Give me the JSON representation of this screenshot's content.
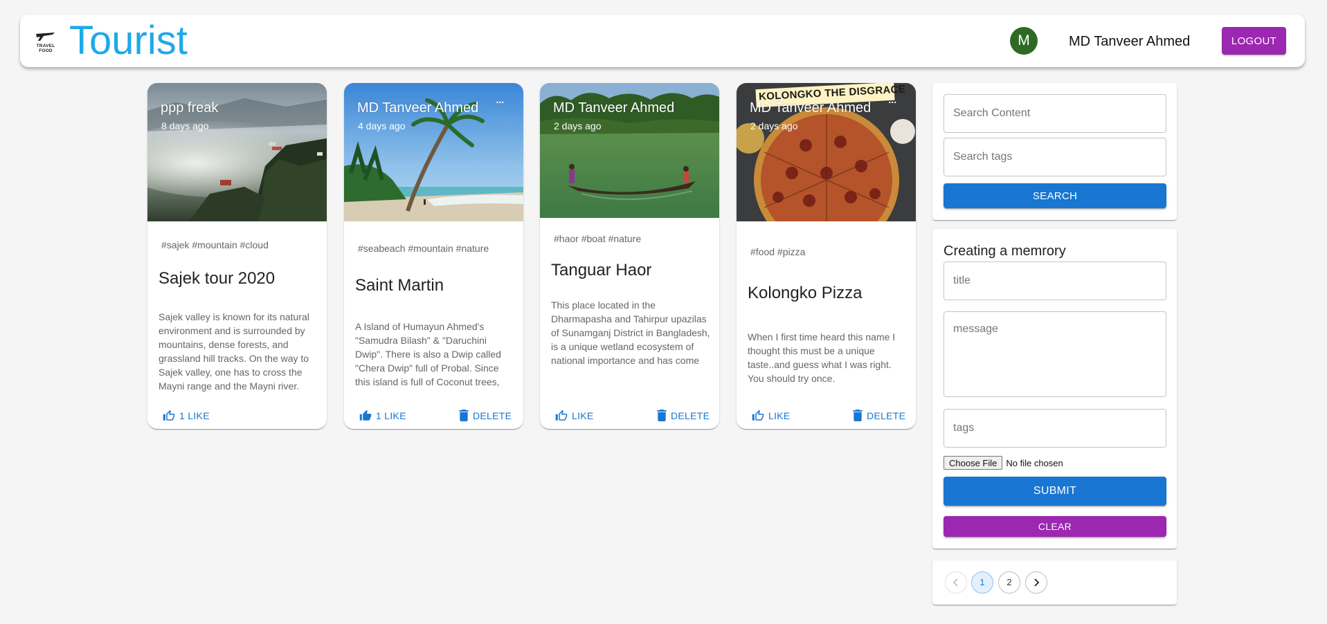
{
  "header": {
    "logo_text": [
      "TRAVEL",
      "FOOD"
    ],
    "brand": "Tourist",
    "avatar_initial": "M",
    "username": "MD Tanveer Ahmed",
    "logout_label": "LOGOUT"
  },
  "posts": [
    {
      "author": "ppp freak",
      "time": "8 days ago",
      "tags": "#sajek #mountain #cloud",
      "title": "Sajek tour 2020",
      "message": "Sajek valley is known for its natural environment and is surrounded by mountains, dense forests, and grassland hill tracks. On the way to Sajek valley, one has to cross the Mayni range and the Mayni river.",
      "like_label": "1 LIKE",
      "image": "mountain-fog-photo"
    },
    {
      "author": "MD Tanveer Ahmed",
      "time": "4 days ago",
      "more": "...",
      "tags": "#seabeach #mountain #nature",
      "title": "Saint Martin",
      "message": "A Island of Humayun Ahmed's \"Samudra Bilash\" & \"Daruchini Dwip\". There is also a Dwip called \"Chera Dwip\" full of Probal. Since this island is full of Coconut trees,",
      "like_label": "1 LIKE",
      "delete_label": "DELETE",
      "image": "beach-palm-photo"
    },
    {
      "author": "MD Tanveer Ahmed",
      "time": "2 days ago",
      "tags": "#haor #boat #nature",
      "title": "Tanguar Haor",
      "message": "This place located in the Dharmapasha and Tahirpur upazilas of Sunamganj District in Bangladesh, is a unique wetland ecosystem of national importance and has come into international focus.",
      "like_label": "LIKE",
      "delete_label": "DELETE",
      "image": "boat-lake-photo"
    },
    {
      "author": "MD Tanveer Ahmed",
      "time": "2 days ago",
      "more": "...",
      "overlay_text": "KOLONGKO THE DISGRACE",
      "tags": "#food #pizza",
      "title": "Kolongko Pizza",
      "message": "When I first time heard this name I thought this must be a unique taste..and guess what I was right. You should try once.",
      "like_label": "LIKE",
      "delete_label": "DELETE",
      "image": "pizza-photo"
    }
  ],
  "search": {
    "content_placeholder": "Search Content",
    "tags_placeholder": "Search tags",
    "button_label": "SEARCH"
  },
  "form": {
    "heading": "Creating a memrory",
    "title_placeholder": "title",
    "message_placeholder": "message",
    "tags_placeholder": "tags",
    "file_button": "Choose File",
    "file_status": "No file chosen",
    "submit_label": "SUBMIT",
    "clear_label": "CLEAR"
  },
  "pagination": {
    "prev": "‹",
    "pages": [
      "1",
      "2"
    ],
    "current": "1",
    "next": "›"
  },
  "colors": {
    "brand": "#1ea9ea",
    "primary": "#1976d2",
    "secondary": "#9c27b0",
    "avatar": "#2e6a24"
  }
}
